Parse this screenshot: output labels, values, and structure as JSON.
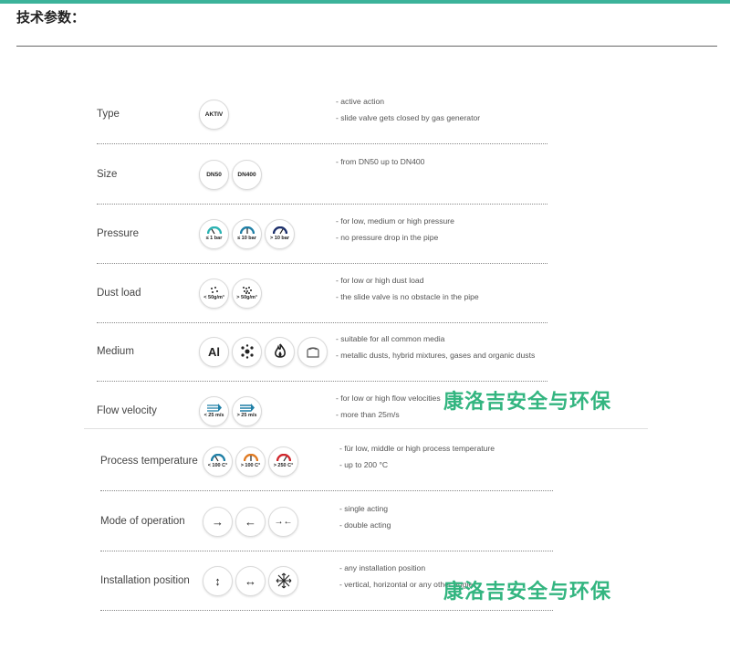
{
  "heading": "技术参数：",
  "rows": [
    {
      "label": "Type",
      "icons": [
        {
          "name": "aktiv-icon",
          "text": "AKTIV"
        }
      ],
      "desc": [
        "- active action",
        "- slide valve gets closed by gas generator"
      ]
    },
    {
      "label": "Size",
      "icons": [
        {
          "name": "dn50-icon",
          "text": "DN50"
        },
        {
          "name": "dn400-icon",
          "text": "DN400"
        }
      ],
      "desc": [
        "- from DN50 up to DN400"
      ]
    },
    {
      "label": "Pressure",
      "icons": [
        {
          "name": "gauge-low-icon",
          "text": "≤ 1 bar",
          "color": "#2bb3b3"
        },
        {
          "name": "gauge-medium-icon",
          "text": "≤ 10 bar",
          "color": "#1f7fa6"
        },
        {
          "name": "gauge-high-icon",
          "text": "> 10 bar",
          "color": "#1c2f6b"
        }
      ],
      "desc": [
        "- for low, medium or high pressure",
        "- no pressure drop in the pipe"
      ]
    },
    {
      "label": "Dust load",
      "icons": [
        {
          "name": "dust-low-icon",
          "text": "< 50g/m³"
        },
        {
          "name": "dust-high-icon",
          "text": "> 50g/m³"
        }
      ],
      "desc": [
        "- for low or high dust load",
        "- the slide valve is no obstacle in the pipe"
      ]
    },
    {
      "label": "Medium",
      "icons": [
        {
          "name": "aluminium-icon",
          "text": "Al"
        },
        {
          "name": "hybrid-mixture-icon",
          "text": ""
        },
        {
          "name": "flame-icon",
          "text": ""
        },
        {
          "name": "organic-dust-icon",
          "text": ""
        }
      ],
      "desc": [
        "- suitable for all common media",
        "- metallic dusts, hybrid mixtures, gases and organic dusts"
      ]
    },
    {
      "label": "Flow velocity",
      "icons": [
        {
          "name": "flow-low-icon",
          "text": "< 25 m/s"
        },
        {
          "name": "flow-high-icon",
          "text": "> 25 m/s"
        }
      ],
      "desc": [
        "- for low or high flow velocities",
        "- more than 25m/s"
      ]
    },
    {
      "label": "Process temperature",
      "icons": [
        {
          "name": "temp-low-icon",
          "text": "< 100 C°",
          "color": "#1f7fa6"
        },
        {
          "name": "temp-mid-icon",
          "text": "> 100 C°",
          "color": "#e07a22"
        },
        {
          "name": "temp-high-icon",
          "text": "> 250 C°",
          "color": "#d0262c"
        }
      ],
      "desc": [
        "- für low, middle or high process temperature",
        "- up to 200 °C"
      ]
    },
    {
      "label": "Mode of operation",
      "icons": [
        {
          "name": "arrow-right-icon",
          "text": "→"
        },
        {
          "name": "arrow-left-icon",
          "text": "←"
        },
        {
          "name": "arrows-converge-icon",
          "text": "→←"
        }
      ],
      "desc": [
        "- single acting",
        "- double acting"
      ]
    },
    {
      "label": "Installation position",
      "icons": [
        {
          "name": "vertical-arrow-icon",
          "text": "↕"
        },
        {
          "name": "horizontal-arrow-icon",
          "text": "↔"
        },
        {
          "name": "any-direction-icon",
          "text": ""
        }
      ],
      "desc": [
        "- any installation position",
        "- vertical, horizontal or any other angle"
      ]
    }
  ],
  "watermark": "康洛吉安全与环保"
}
